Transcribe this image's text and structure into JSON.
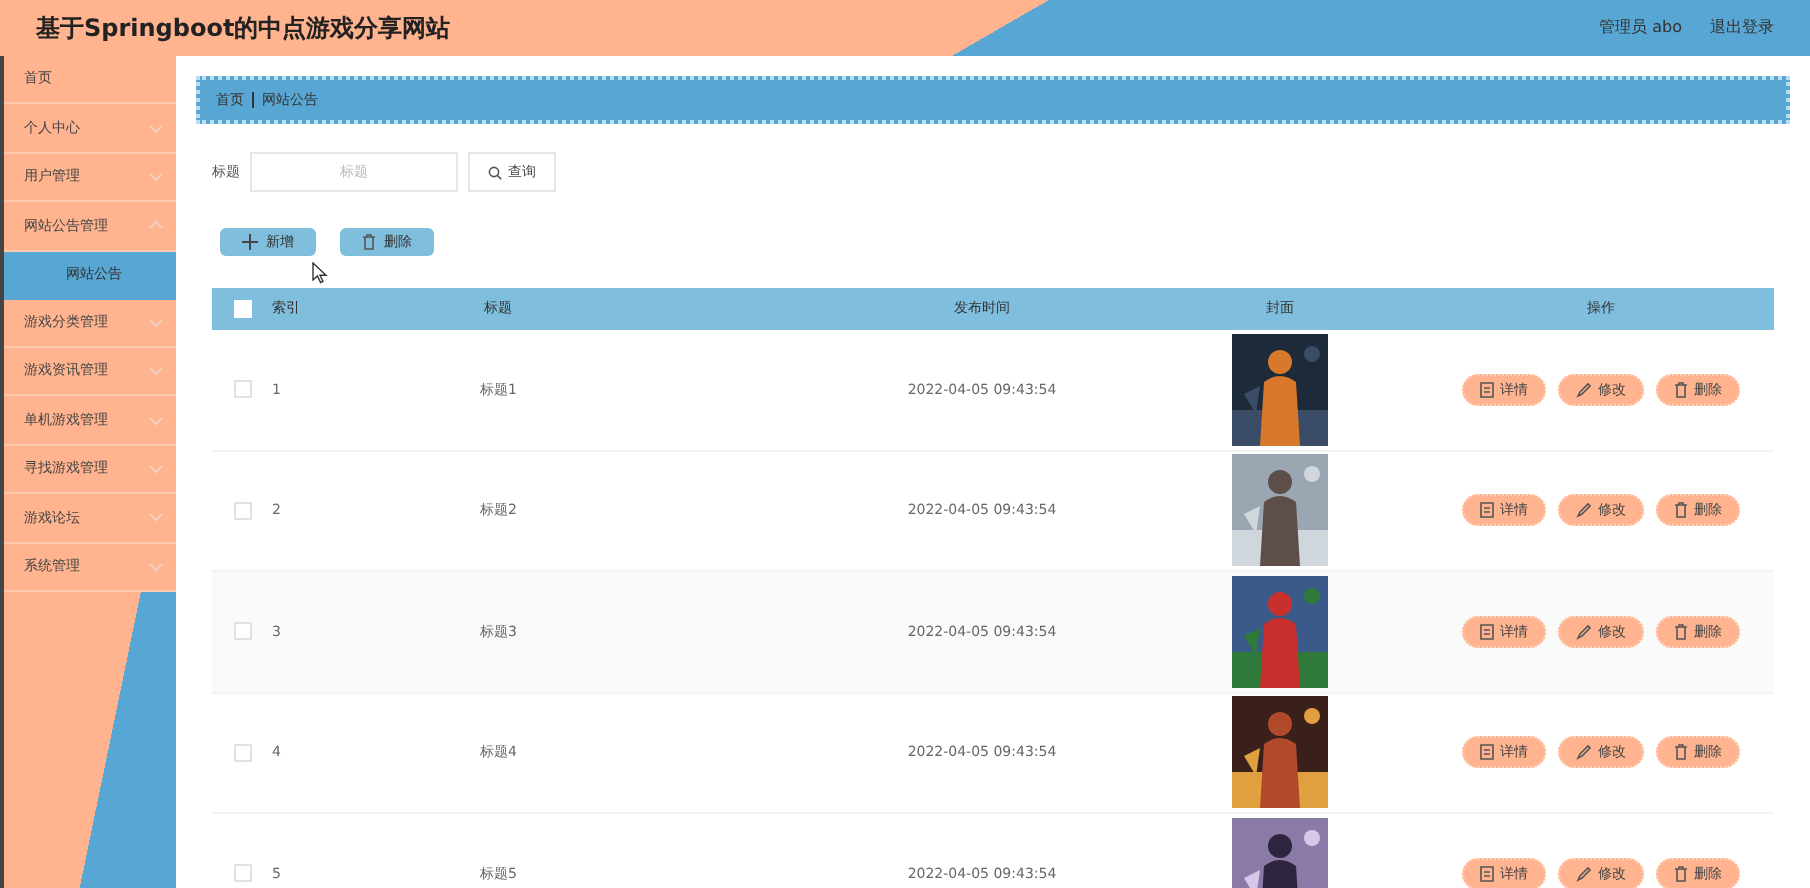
{
  "header": {
    "title": "基于Springboot的中点游戏分享网站",
    "user": "管理员 abo",
    "logout": "退出登录"
  },
  "sidebar": {
    "items": [
      {
        "kind": "link",
        "label": "首页",
        "selected": false
      },
      {
        "kind": "menu",
        "label": "个人中心",
        "selected": false,
        "expanded": false
      },
      {
        "kind": "menu",
        "label": "用户管理",
        "selected": false,
        "expanded": false
      },
      {
        "kind": "menu",
        "label": "网站公告管理",
        "selected": false,
        "expanded": true,
        "children": [
          {
            "label": "网站公告",
            "selected": true
          }
        ]
      },
      {
        "kind": "menu",
        "label": "游戏分类管理",
        "selected": false,
        "expanded": false
      },
      {
        "kind": "menu",
        "label": "游戏资讯管理",
        "selected": false,
        "expanded": false
      },
      {
        "kind": "menu",
        "label": "单机游戏管理",
        "selected": false,
        "expanded": false
      },
      {
        "kind": "menu",
        "label": "寻找游戏管理",
        "selected": false,
        "expanded": false
      },
      {
        "kind": "menu",
        "label": "游戏论坛",
        "selected": false,
        "expanded": false
      },
      {
        "kind": "menu",
        "label": "系统管理",
        "selected": false,
        "expanded": false
      }
    ]
  },
  "breadcrumb": [
    "首页",
    "网站公告"
  ],
  "search": {
    "label": "标题",
    "placeholder": "标题",
    "button": "查询"
  },
  "actions": [
    {
      "kind": "add",
      "label": "新增"
    },
    {
      "kind": "delete",
      "label": "删除"
    }
  ],
  "table": {
    "all_checked": false,
    "columns": [
      "索引",
      "标题",
      "发布时间",
      "封面",
      "操作"
    ],
    "rows": [
      {
        "index": "1",
        "title": "标题1",
        "time": "2022-04-05 09:43:54",
        "checked": false,
        "actions": [
          {
            "kind": "detail",
            "label": "详情"
          },
          {
            "kind": "edit",
            "label": "修改"
          },
          {
            "kind": "delete",
            "label": "删除"
          }
        ]
      },
      {
        "index": "2",
        "title": "标题2",
        "time": "2022-04-05 09:43:54",
        "checked": false,
        "actions": [
          {
            "kind": "detail",
            "label": "详情"
          },
          {
            "kind": "edit",
            "label": "修改"
          },
          {
            "kind": "delete",
            "label": "删除"
          }
        ]
      },
      {
        "index": "3",
        "title": "标题3",
        "time": "2022-04-05 09:43:54",
        "checked": false,
        "actions": [
          {
            "kind": "detail",
            "label": "详情"
          },
          {
            "kind": "edit",
            "label": "修改"
          },
          {
            "kind": "delete",
            "label": "删除"
          }
        ]
      },
      {
        "index": "4",
        "title": "标题4",
        "time": "2022-04-05 09:43:54",
        "checked": false,
        "actions": [
          {
            "kind": "detail",
            "label": "详情"
          },
          {
            "kind": "edit",
            "label": "修改"
          },
          {
            "kind": "delete",
            "label": "删除"
          }
        ]
      },
      {
        "index": "5",
        "title": "标题5",
        "time": "2022-04-05 09:43:54",
        "checked": false,
        "actions": [
          {
            "kind": "detail",
            "label": "详情"
          },
          {
            "kind": "edit",
            "label": "修改"
          },
          {
            "kind": "delete",
            "label": "删除"
          }
        ]
      }
    ]
  }
}
